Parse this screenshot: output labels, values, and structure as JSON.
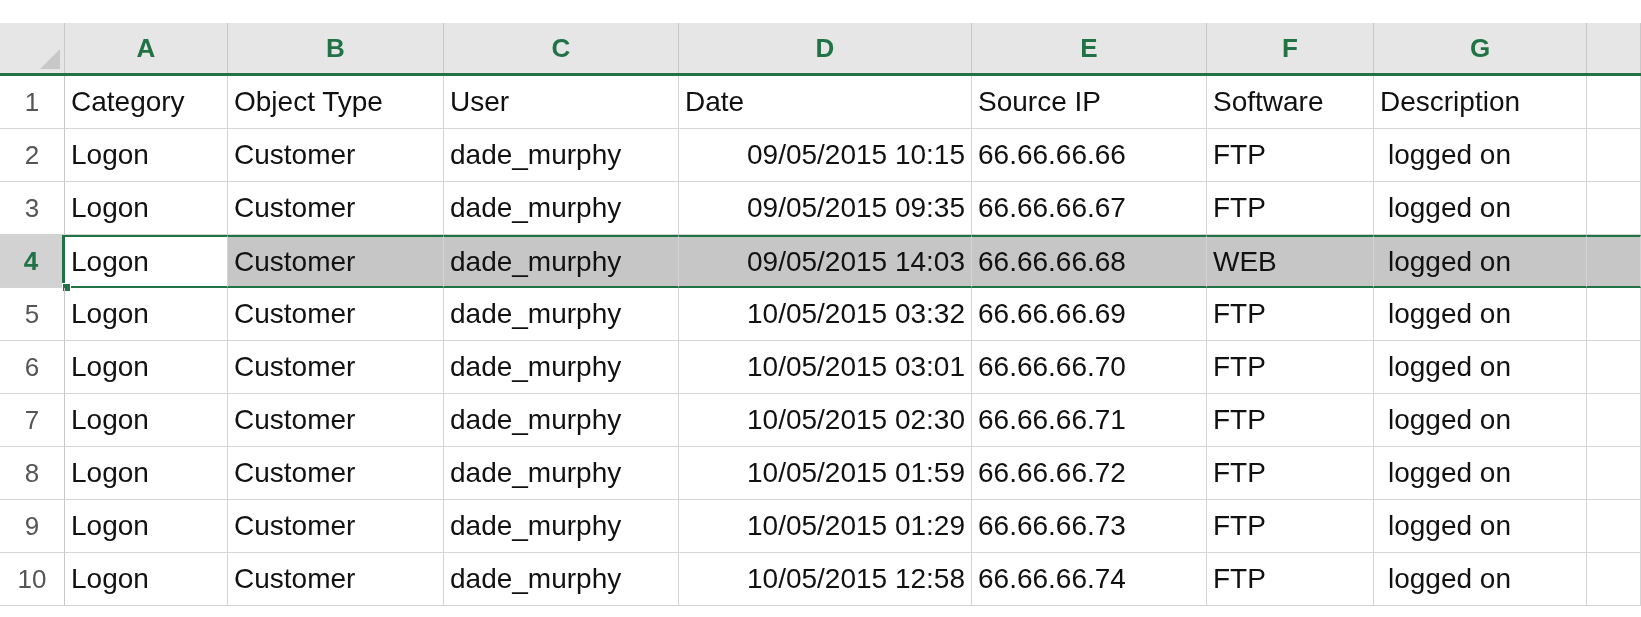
{
  "columns": [
    {
      "label": "A",
      "selected": true
    },
    {
      "label": "B",
      "selected": true
    },
    {
      "label": "C",
      "selected": true
    },
    {
      "label": "D",
      "selected": true
    },
    {
      "label": "E",
      "selected": true
    },
    {
      "label": "F",
      "selected": true
    },
    {
      "label": "G",
      "selected": true
    }
  ],
  "rows": [
    {
      "number": "1",
      "selected": false,
      "cells": [
        "Category",
        "Object Type",
        "User",
        "Date",
        "Source IP",
        "Software",
        "Description"
      ]
    },
    {
      "number": "2",
      "selected": false,
      "cells": [
        "Logon",
        "Customer",
        "dade_murphy",
        "09/05/2015 10:15",
        "66.66.66.66",
        "FTP",
        "logged on"
      ]
    },
    {
      "number": "3",
      "selected": false,
      "cells": [
        "Logon",
        "Customer",
        "dade_murphy",
        "09/05/2015 09:35",
        "66.66.66.67",
        "FTP",
        "logged on"
      ]
    },
    {
      "number": "4",
      "selected": true,
      "cells": [
        "Logon",
        "Customer",
        "dade_murphy",
        "09/05/2015 14:03",
        "66.66.66.68",
        "WEB",
        "logged on"
      ]
    },
    {
      "number": "5",
      "selected": false,
      "cells": [
        "Logon",
        "Customer",
        "dade_murphy",
        "10/05/2015 03:32",
        "66.66.66.69",
        "FTP",
        "logged on"
      ]
    },
    {
      "number": "6",
      "selected": false,
      "cells": [
        "Logon",
        "Customer",
        "dade_murphy",
        "10/05/2015 03:01",
        "66.66.66.70",
        "FTP",
        "logged on"
      ]
    },
    {
      "number": "7",
      "selected": false,
      "cells": [
        "Logon",
        "Customer",
        "dade_murphy",
        "10/05/2015 02:30",
        "66.66.66.71",
        "FTP",
        "logged on"
      ]
    },
    {
      "number": "8",
      "selected": false,
      "cells": [
        "Logon",
        "Customer",
        "dade_murphy",
        "10/05/2015 01:59",
        "66.66.66.72",
        "FTP",
        "logged on"
      ]
    },
    {
      "number": "9",
      "selected": false,
      "cells": [
        "Logon",
        "Customer",
        "dade_murphy",
        "10/05/2015 01:29",
        "66.66.66.73",
        "FTP",
        "logged on"
      ]
    },
    {
      "number": "10",
      "selected": false,
      "cells": [
        "Logon",
        "Customer",
        "dade_murphy",
        "10/05/2015 12:58",
        "66.66.66.74",
        "FTP",
        "logged on"
      ]
    }
  ]
}
